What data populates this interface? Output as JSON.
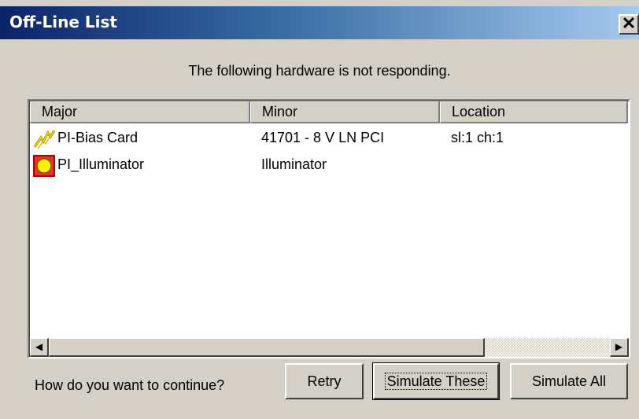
{
  "window": {
    "title": "Off-Line List",
    "close_glyph": "✕"
  },
  "message": "The following hardware is not responding.",
  "list": {
    "columns": [
      "Major",
      "Minor",
      "Location"
    ],
    "rows": [
      {
        "major": "PI-Bias Card",
        "minor": "41701 - 8 V LN PCI",
        "location": "sl:1 ch:1",
        "icon": "bias-card-icon"
      },
      {
        "major": "PI_Illuminator",
        "minor": "Illuminator",
        "location": "",
        "icon": "illuminator-icon"
      }
    ]
  },
  "scrollbar": {
    "left_glyph": "◀",
    "right_glyph": "▶"
  },
  "footer": {
    "prompt": "How do you want to continue?",
    "retry_label": "Retry",
    "simulate_these_label": "Simulate These",
    "simulate_all_label": "Simulate All"
  },
  "colors": {
    "titlebar_start": "#0a246a",
    "titlebar_end": "#a6caf0",
    "face": "#d4d0c8"
  }
}
